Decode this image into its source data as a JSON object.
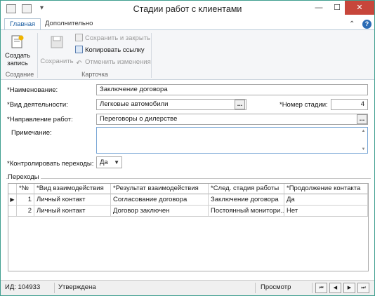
{
  "window": {
    "title": "Стадии работ с клиентами",
    "controls": {
      "minimize": "—",
      "maximize": "☐",
      "close": "✕"
    }
  },
  "ribbon": {
    "tabs": [
      {
        "label": "Главная",
        "active": true
      },
      {
        "label": "Дополнительно",
        "active": false
      }
    ],
    "groups": {
      "create": {
        "label": "Создание",
        "create_button": "Создать запись"
      },
      "card": {
        "label": "Карточка",
        "save_button": "Сохранить",
        "save_close": "Сохранить и закрыть",
        "copy_link": "Копировать ссылку",
        "undo_changes": "Отменить изменения"
      }
    },
    "help": "?",
    "collapse": "⌃"
  },
  "form": {
    "name_label": "*Наименование:",
    "name_value": "Заключение договора",
    "activity_label": "*Вид деятельности:",
    "activity_value": "Легковые автомобили",
    "stage_no_label": "*Номер стадии:",
    "stage_no_value": "4",
    "direction_label": "*Направление работ:",
    "direction_value": "Переговоры о дилерстве",
    "note_label": "Примечание:",
    "note_value": "",
    "control_label": "*Контролировать переходы:",
    "control_value": "Да",
    "ellipsis": "..."
  },
  "transitions": {
    "legend": "Переходы",
    "columns": [
      "*№",
      "*Вид взаимодействия",
      "*Результат взаимодействия",
      "*След. стадия работы",
      "*Продолжение контакта"
    ],
    "rows": [
      {
        "indicator": "▶",
        "no": "1",
        "type": "Личный контакт",
        "result": "Согласование договора",
        "next": "Заключение договора",
        "cont": "Да"
      },
      {
        "indicator": "",
        "no": "2",
        "type": "Личный контакт",
        "result": "Договор заключен",
        "next": "Постоянный монитори...",
        "cont": "Нет"
      }
    ]
  },
  "status": {
    "id": "ИД: 104933",
    "state": "Утверждена",
    "mode": "Просмотр",
    "nav": [
      "⏮",
      "◀",
      "▶",
      "⏭"
    ]
  },
  "colors": {
    "accent": "#1c5fa3",
    "frame": "#3f9f8f",
    "close": "#c7463b"
  }
}
